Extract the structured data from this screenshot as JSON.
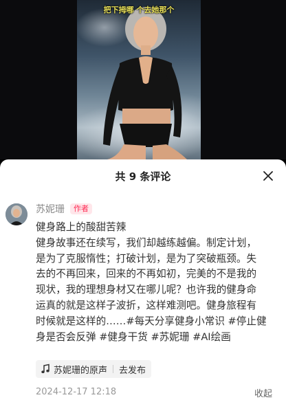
{
  "video": {
    "subtitle": "把下拇哪 个去她那个"
  },
  "comments_panel": {
    "title": "共 9 条评论",
    "close_icon": "close-icon"
  },
  "comment": {
    "author": "苏妮珊",
    "badge": "作者",
    "lines": [
      "健身路上的酸甜苦辣",
      "健身故事还在续写，我们却越练越偏。制定计划，",
      "是为了克服惰性；打破计划，是为了突破瓶颈。失",
      "去的不再回来，回来的不再如初，完美的不是我的",
      "现状，我的理想身材又在哪儿呢？也许我的健身命",
      "运真的就是这样子波折，这样难测吧。健身旅程有",
      "时候就是这样的……#每天分享健身小常识 #停止健",
      "身是否会反弹 #健身干货 #苏妮珊 #AI绘画"
    ],
    "music": {
      "icon": "music-note-icon",
      "name": "苏妮珊的原声",
      "action": "去发布"
    },
    "timestamp": "2024-12-17 12:18",
    "collapse_label": "收起"
  },
  "colors": {
    "badge_text": "#ff2d55",
    "badge_bg": "#ffe6ea",
    "sheet_bg": "#ffffff"
  }
}
